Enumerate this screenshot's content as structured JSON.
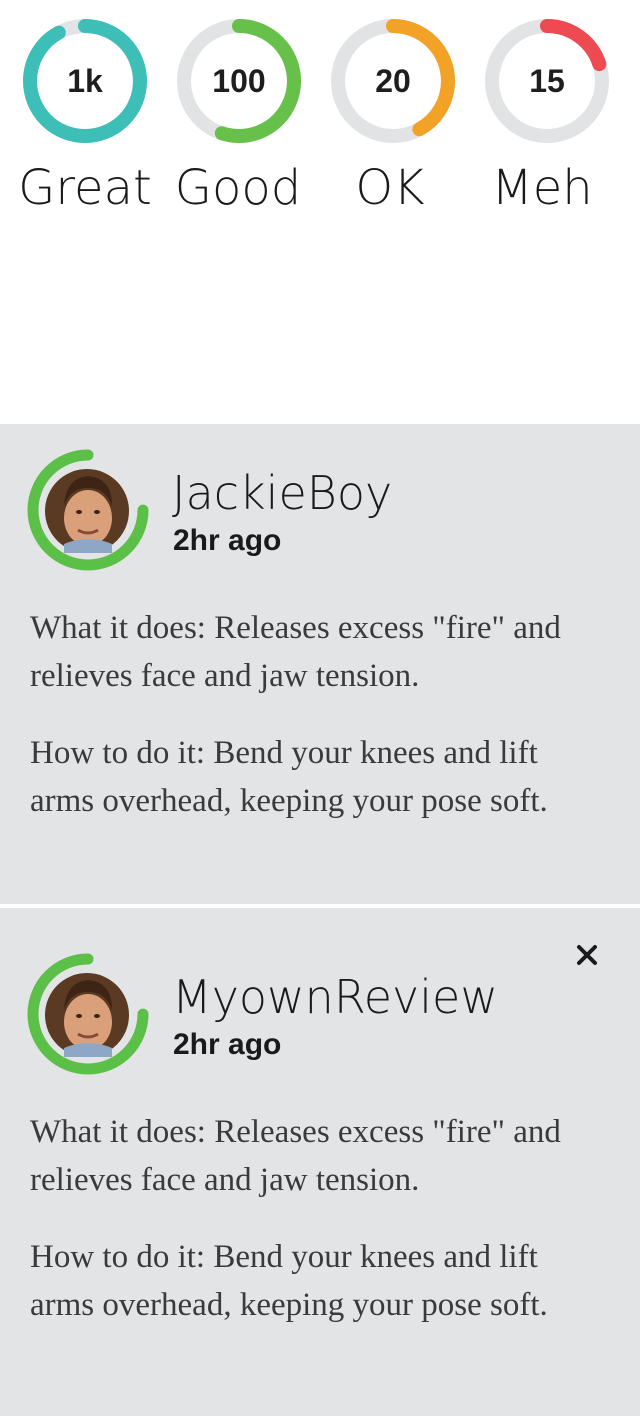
{
  "ratings": [
    {
      "value": "1k",
      "label": "Great",
      "color": "#3dbfb8",
      "fraction": 0.92
    },
    {
      "value": "100",
      "label": "Good",
      "color": "#66c049",
      "fraction": 0.55
    },
    {
      "value": "20",
      "label": "OK",
      "color": "#f2a227",
      "fraction": 0.42
    },
    {
      "value": "15",
      "label": "Meh",
      "color": "#ee4a51",
      "fraction": 0.2
    }
  ],
  "reviews": [
    {
      "username": "JackieBoy",
      "time": "2hr ago",
      "ring_color": "#5cbf47",
      "ring_fraction": 0.75,
      "what_it_does": "What it does: Releases excess \"fire\" and relieves face and jaw tension.",
      "how_to": "How to do it: Bend your knees and lift arms overhead, keeping your pose soft.",
      "closable": false
    },
    {
      "username": "MyownReview",
      "time": "2hr ago",
      "ring_color": "#5cbf47",
      "ring_fraction": 0.75,
      "what_it_does": "What it does: Releases excess \"fire\" and relieves face and jaw tension.",
      "how_to": "How to do it: Bend your knees and lift arms overhead, keeping your pose soft.",
      "closable": true,
      "close_icon": "close-icon"
    }
  ],
  "colors": {
    "track": "#e2e3e5",
    "card_bg": "#e3e4e6"
  }
}
